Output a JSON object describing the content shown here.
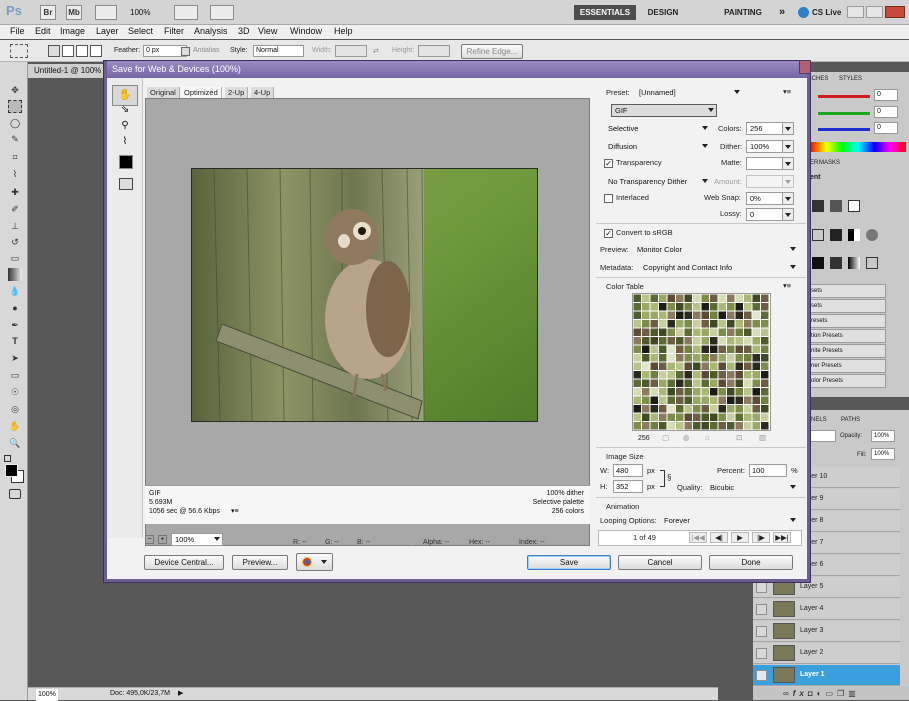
{
  "app": {
    "logo": "Ps",
    "bridge": "Br",
    "minibridge": "Mb",
    "zoom": "100%",
    "workspaces": [
      "ESSENTIALS",
      "DESIGN",
      "PAINTING"
    ],
    "more": "»",
    "cslive": "CS Live"
  },
  "menu": [
    "File",
    "Edit",
    "Image",
    "Layer",
    "Select",
    "Filter",
    "Analysis",
    "3D",
    "View",
    "Window",
    "Help"
  ],
  "options": {
    "feather_label": "Feather:",
    "feather_value": "0 px",
    "antialias_label": "Antialias",
    "style_label": "Style:",
    "style_value": "Normal",
    "width_label": "Width:",
    "height_label": "Height:",
    "refine_edge": "Refine Edge..."
  },
  "document": {
    "tab": "Untitled-1 @ 100%",
    "status_zoom": "100%",
    "status_doc": "Doc: 495,0K/23,7M"
  },
  "panels": {
    "tabs_top": [
      "ICHES",
      "STYLES"
    ],
    "color_values": [
      "0",
      "0",
      "0"
    ],
    "tabs_mid": [
      "ER",
      "MASKS"
    ],
    "adjust_title": "ent",
    "presets": [
      "sets",
      "sets",
      "resets",
      "tion Presets",
      "nite Presets",
      "ner Presets",
      "olor Presets"
    ],
    "tabs_layers": [
      "NELS",
      "PATHS"
    ],
    "opacity_label": "Opacity:",
    "opacity_value": "100%",
    "fill_label": "Fill:",
    "fill_value": "100%",
    "layers": [
      "Layer 10",
      "Layer 9",
      "Layer 8",
      "Layer 7",
      "Layer 6",
      "Layer 5",
      "Layer 4",
      "Layer 3",
      "Layer 2",
      "Layer 1"
    ]
  },
  "dialog": {
    "title": "Save for Web & Devices (100%)",
    "tabs": [
      "Original",
      "Optimized",
      "2-Up",
      "4-Up"
    ],
    "info_left": [
      "GIF",
      "5.693M",
      "1056 sec @ 56.6 Kbps"
    ],
    "info_right": [
      "100% dither",
      "Selective palette",
      "256 colors"
    ],
    "zoom_value": "100%",
    "readout": {
      "r": "R: --",
      "g": "G: --",
      "b": "B: --",
      "alpha": "Alpha: --",
      "hex": "Hex: --",
      "index": "Index: --"
    },
    "preset_label": "Preset:",
    "preset_value": "[Unnamed]",
    "format": "GIF",
    "reduction": "Selective",
    "colors_label": "Colors:",
    "colors_value": "256",
    "dither_algo": "Diffusion",
    "dither_label": "Dither:",
    "dither_value": "100%",
    "transparency_label": "Transparency",
    "matte_label": "Matte:",
    "transp_dither": "No Transparency Dither",
    "amount_label": "Amount:",
    "interlaced_label": "Interlaced",
    "websnap_label": "Web Snap:",
    "websnap_value": "0%",
    "lossy_label": "Lossy:",
    "lossy_value": "0",
    "convert_label": "Convert to sRGB",
    "preview_label": "Preview:",
    "preview_value": "Monitor Color",
    "metadata_label": "Metadata:",
    "metadata_value": "Copyright and Contact Info",
    "color_table_label": "Color Table",
    "color_count": "256",
    "image_size_label": "Image Size",
    "w_label": "W:",
    "w_value": "480",
    "h_label": "H:",
    "h_value": "352",
    "px": "px",
    "percent_label": "Percent:",
    "percent_value": "100",
    "percent_unit": "%",
    "quality_label": "Quality:",
    "quality_value": "Bicubic",
    "animation_label": "Animation",
    "looping_label": "Looping Options:",
    "looping_value": "Forever",
    "frame_counter": "1 of 49",
    "buttons": {
      "device_central": "Device Central...",
      "preview": "Preview...",
      "save": "Save",
      "cancel": "Cancel",
      "done": "Done"
    }
  }
}
